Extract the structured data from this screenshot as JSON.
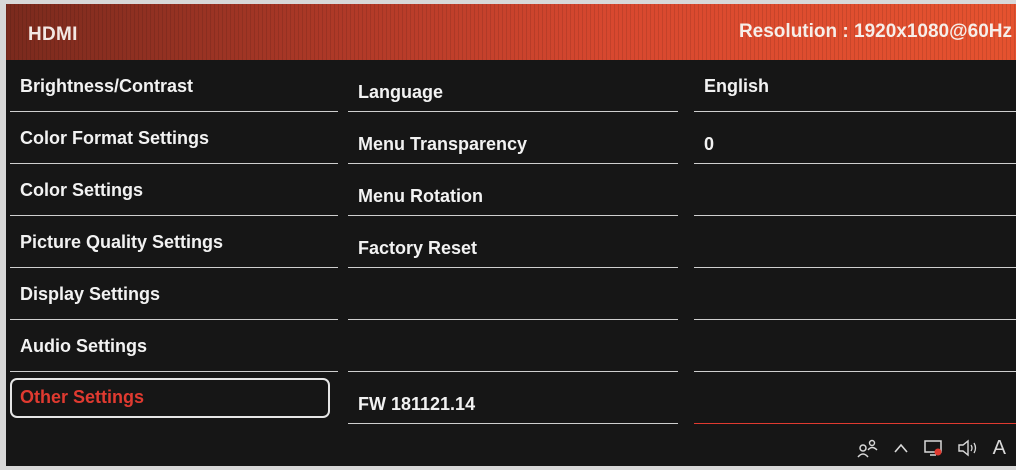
{
  "header": {
    "input_name": "HDMI",
    "resolution": "Resolution : 1920x1080@60Hz"
  },
  "menu": {
    "items": [
      {
        "label": "Brightness/Contrast"
      },
      {
        "label": "Color Format Settings"
      },
      {
        "label": "Color Settings"
      },
      {
        "label": "Picture Quality Settings"
      },
      {
        "label": "Display Settings"
      },
      {
        "label": "Audio Settings"
      },
      {
        "label": "Other Settings",
        "selected": true
      }
    ]
  },
  "submenu": {
    "items": [
      {
        "label": "Language"
      },
      {
        "label": "Menu Transparency"
      },
      {
        "label": "Menu Rotation"
      },
      {
        "label": "Factory Reset"
      },
      {
        "label": ""
      },
      {
        "label": ""
      },
      {
        "label": "FW 181121.14"
      }
    ]
  },
  "values": {
    "items": [
      {
        "label": "English"
      },
      {
        "label": "0"
      },
      {
        "label": ""
      },
      {
        "label": ""
      },
      {
        "label": ""
      },
      {
        "label": ""
      },
      {
        "label": ""
      }
    ]
  },
  "tray": {
    "icons": [
      "people-icon",
      "chevron-up-icon",
      "network-icon",
      "speaker-icon"
    ],
    "ime_indicator": "A"
  },
  "colors": {
    "accent_red": "#e03a30",
    "header_red": "#d8482f",
    "background": "#161616"
  }
}
